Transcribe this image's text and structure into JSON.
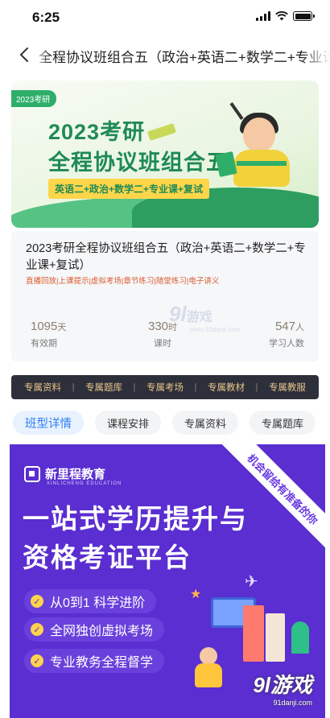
{
  "status_bar": {
    "time": "6:25"
  },
  "nav": {
    "back_icon": "chevron-left-icon",
    "title": "全程协议班组合五（政治+英语二+数学二+专业课"
  },
  "hero": {
    "tag": "2023考研",
    "title_line1": "2023考研",
    "title_line2": "全程协议班组合五",
    "subjects": "英语二+政治+数学二+专业课+复试"
  },
  "course": {
    "title": "2023考研全程协议班组合五（政治+英语二+数学二+专业课+复试）",
    "features": "直播回放|上课提示|虚拟考场|章节练习|随堂练习|电子讲义",
    "stats": [
      {
        "value": "1095",
        "unit": "天",
        "label": "有效期"
      },
      {
        "value": "330",
        "unit": "时",
        "label": "课时"
      },
      {
        "value": "547",
        "unit": "人",
        "label": "学习人数"
      }
    ]
  },
  "watermark": {
    "logo": "9l",
    "cn": "游戏",
    "url": "www.91danji.com"
  },
  "resources": [
    "专属资料",
    "专属题库",
    "专属考场",
    "专属教材",
    "专属教服"
  ],
  "resource_separator": "|",
  "tabs": [
    "班型详情",
    "课程安排",
    "专属资料",
    "专属题库"
  ],
  "poster": {
    "brand": "新里程教育",
    "brand_en": "XINLICHENG EDUCATION",
    "ribbon": "机会留给有准备的你",
    "headline1": "一站式学历提升与",
    "headline2": "资格考证平台",
    "points": [
      "从0到1 科学进阶",
      "全网独创虚拟考场",
      "专业教务全程督学"
    ]
  },
  "bottom_watermark": {
    "logo": "9l游戏",
    "url": "91danji.com"
  }
}
